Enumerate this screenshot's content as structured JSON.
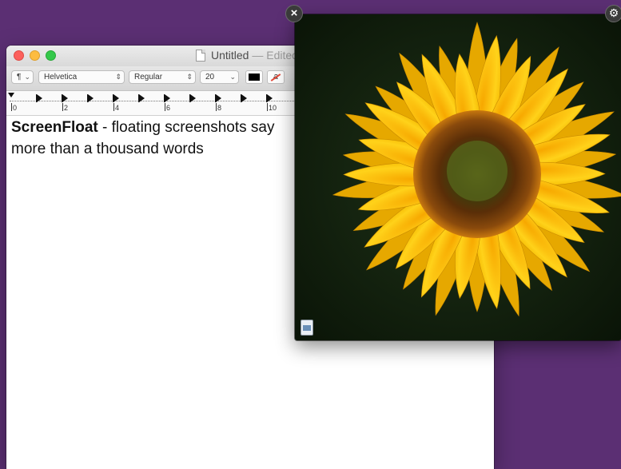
{
  "textedit": {
    "title": "Untitled",
    "title_suffix": "— Edited",
    "toolbar": {
      "paragraph_style": "¶",
      "font_family": "Helvetica",
      "font_style": "Regular",
      "font_size": "20"
    },
    "ruler_numbers": [
      "0",
      "2",
      "4",
      "6",
      "8",
      "10"
    ],
    "document": {
      "bold_text": "ScreenFloat",
      "body_text": " - floating screenshots say more than a thousand words"
    }
  },
  "floating_panel": {
    "close_icon": "×",
    "gear_icon": "⚙",
    "image_subject": "sunflower",
    "colors": {
      "petal": "#f5c200",
      "center": "#6b3a0c",
      "background": "#152312"
    }
  }
}
